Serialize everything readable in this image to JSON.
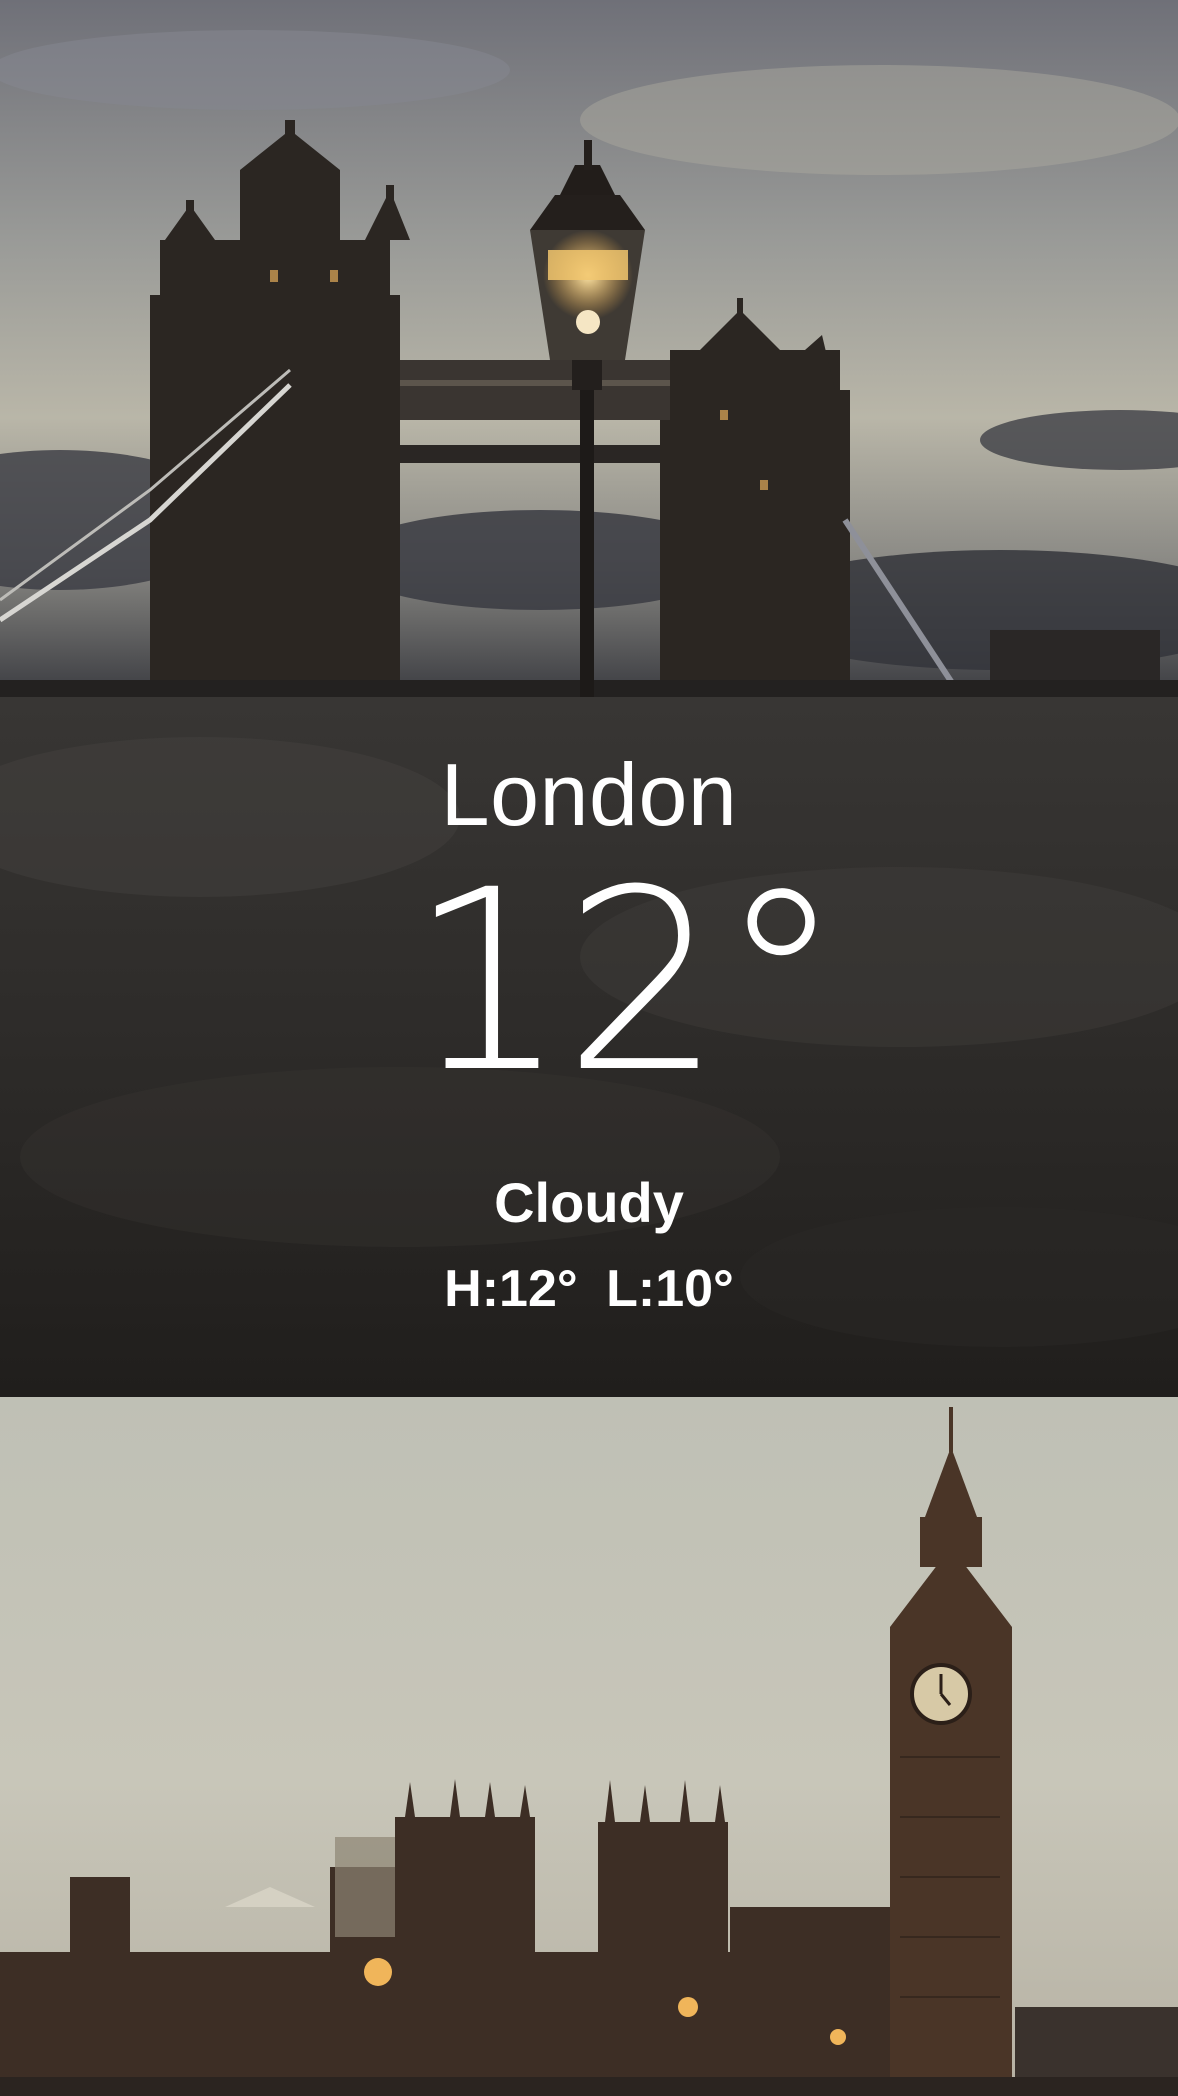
{
  "weather": {
    "city": "London",
    "temperature": "12°",
    "condition": "Cloudy",
    "high_low": "H:12°  L:10°"
  },
  "colors": {
    "text": "#ffffff",
    "panel_background": "#2b2927"
  }
}
